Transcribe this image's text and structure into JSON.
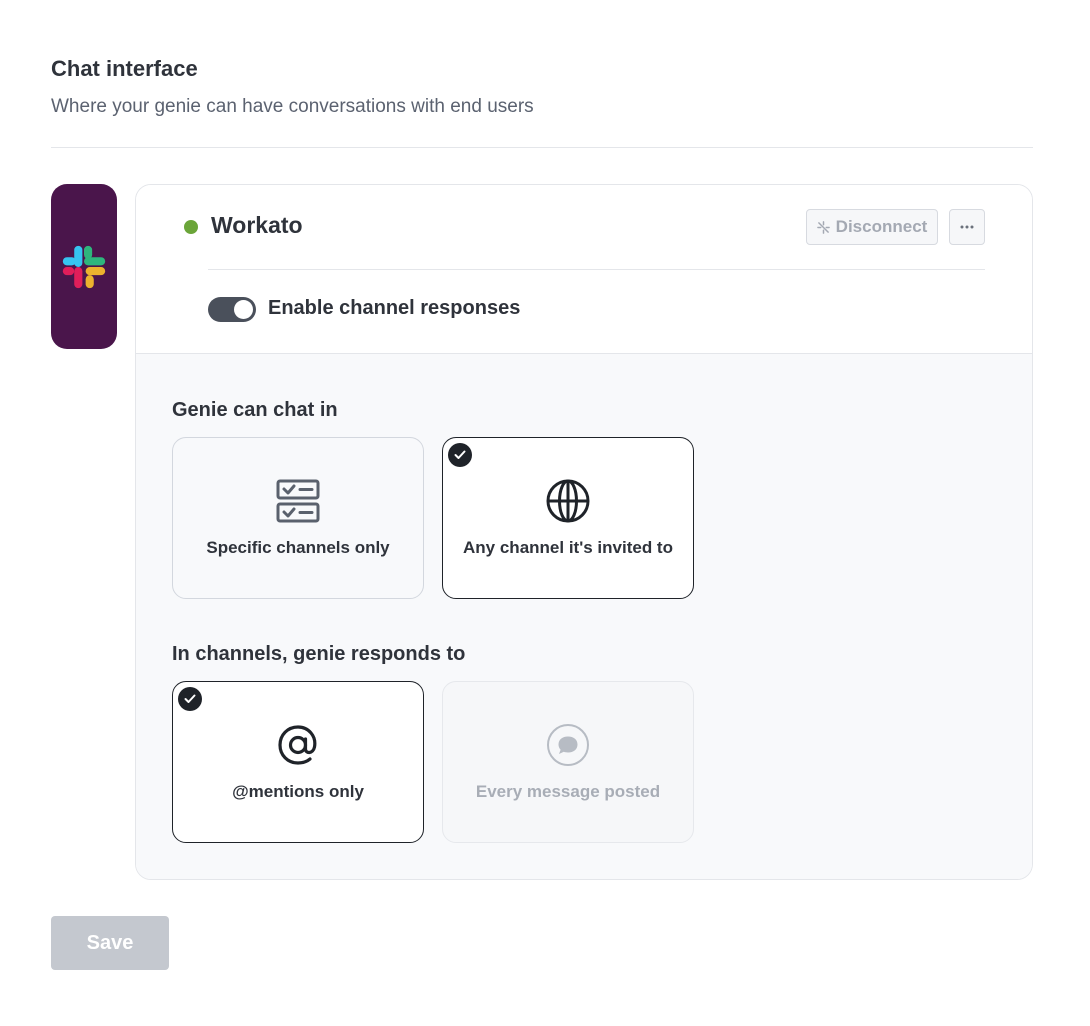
{
  "section": {
    "title": "Chat interface",
    "subtitle": "Where your genie can have conversations with end users"
  },
  "app": {
    "logo_icon": "slack-logo-icon",
    "workspace_name": "Workato",
    "status": "connected",
    "status_color": "#6ba539",
    "disconnect_label": "Disconnect",
    "more_icon": "more-horizontal-icon",
    "toggle": {
      "label": "Enable channel responses",
      "enabled": true
    }
  },
  "chat_in": {
    "label": "Genie can chat in",
    "options": [
      {
        "label": "Specific channels only",
        "icon": "channel-list-icon",
        "selected": false
      },
      {
        "label": "Any channel it's invited to",
        "icon": "globe-icon",
        "selected": true
      }
    ]
  },
  "responds_to": {
    "label": "In channels, genie responds to",
    "options": [
      {
        "label": "@mentions only",
        "icon": "at-sign-icon",
        "selected": true
      },
      {
        "label": "Every message posted",
        "icon": "chat-bubble-icon",
        "selected": false,
        "disabled": true
      }
    ]
  },
  "footer": {
    "save_label": "Save"
  }
}
